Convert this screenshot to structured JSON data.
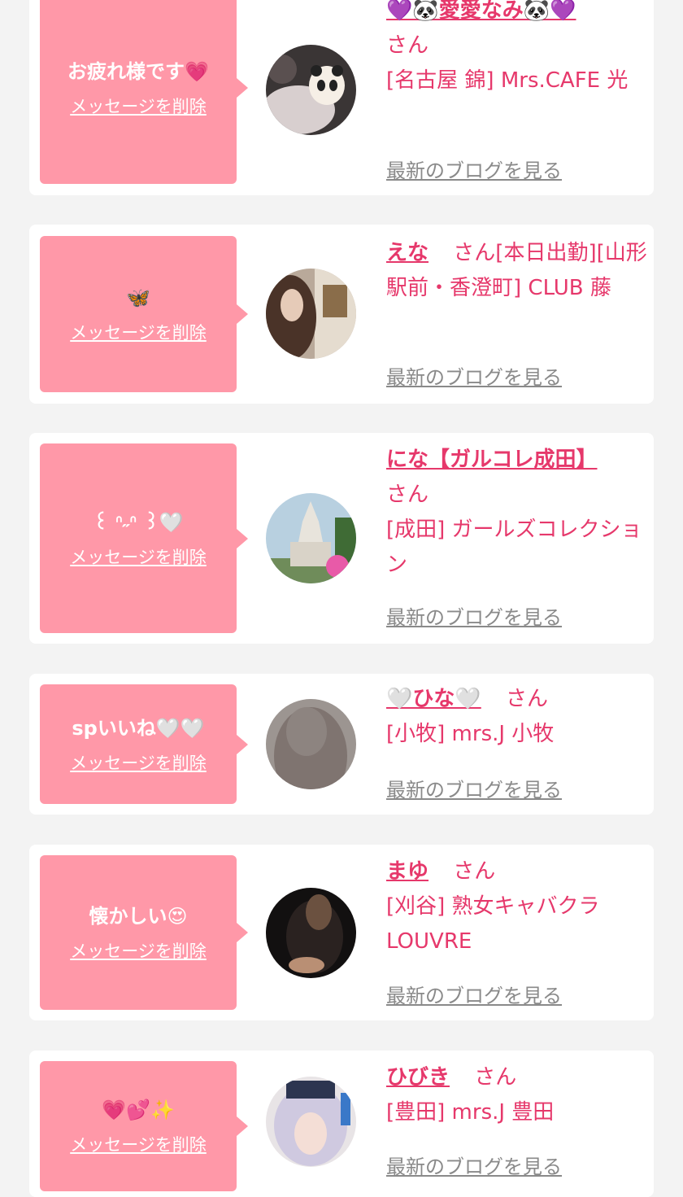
{
  "delete_label": "メッセージを削除",
  "blog_label": "最新のブログを見る",
  "san": "さん",
  "colors": {
    "background": "#f3f3f3",
    "bubble": "#ff98a8",
    "accent": "#e6386b",
    "link_gray": "#8a8a8a"
  },
  "items": [
    {
      "message": "お疲れ様です💗",
      "name": "💜🐼愛愛なみ🐼💜",
      "shop": "[名古屋 錦] Mrs.CAFE 光"
    },
    {
      "message": "🦋",
      "name": "えな",
      "shop": "[本日出勤][山形駅前・香澄町] CLUB 藤"
    },
    {
      "message": "꒰ ᐢ˶ᐢ ꒱🤍",
      "name": "にな【ガルコレ成田】",
      "shop": "[成田] ガールズコレクション"
    },
    {
      "message": "spいいね🤍🤍",
      "name": "🤍ひな🤍",
      "shop": "[小牧] mrs.J 小牧"
    },
    {
      "message": "懐かしい😍",
      "name": "まゆ",
      "shop": "[刈谷] 熟女キャバクラLOUVRE"
    },
    {
      "message": "💗💕✨",
      "name": "ひびき",
      "shop": "[豊田] mrs.J 豊田"
    }
  ]
}
